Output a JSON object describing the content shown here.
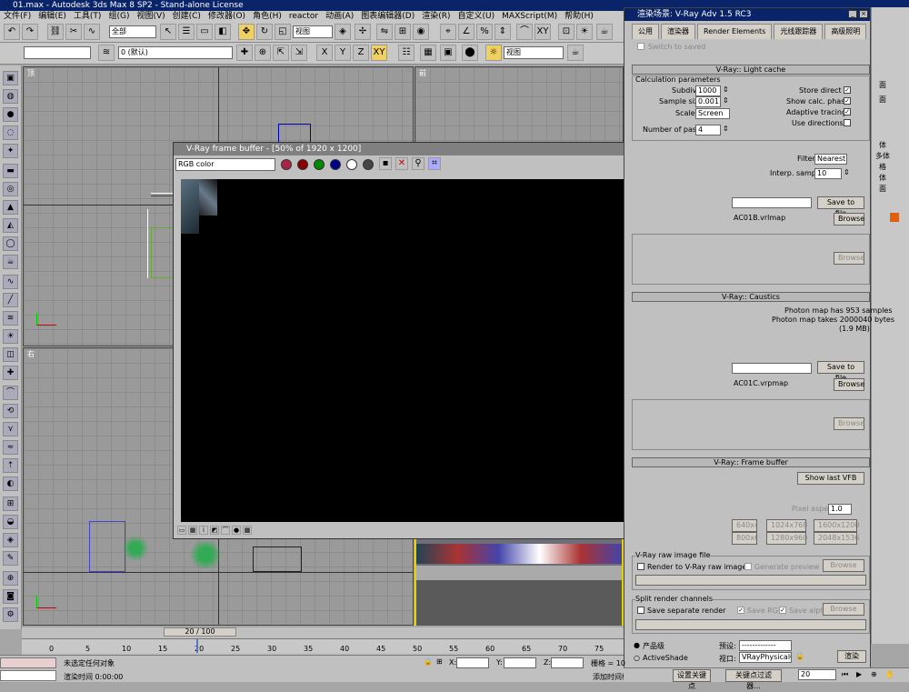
{
  "app": {
    "title": "01.max - Autodesk 3ds Max 8 SP2 - Stand-alone License"
  },
  "menu": [
    "文件(F)",
    "编辑(E)",
    "工具(T)",
    "组(G)",
    "视图(V)",
    "创建(C)",
    "修改器(O)",
    "角色(H)",
    "reactor",
    "动画(A)",
    "图表编辑器(D)",
    "渲染(R)",
    "自定义(U)",
    "MAXScript(M)",
    "帮助(H)"
  ],
  "toolbar": {
    "selection_filter": "全部",
    "ref_coord": "视图",
    "layer_value": "0 (默认)",
    "named_sel": "视图"
  },
  "viewports": {
    "top_left_label": "顶",
    "top_right_label": "前",
    "bottom_left_label": "右"
  },
  "vfb": {
    "title": "V-Ray frame buffer - [50% of 1920 x 1200]",
    "channel": "RGB color"
  },
  "render_dialog": {
    "title": "渲染场景: V-Ray Adv 1.5 RC3",
    "tabs": [
      "公用",
      "渲染器",
      "Render Elements",
      "光线跟踪器",
      "高级照明"
    ],
    "switch_to_saved": "Switch to saved",
    "light_cache_bar": "V-Ray:: Light cache",
    "calc_params": "Calculation parameters",
    "subdivs_label": "Subdivs:",
    "subdivs_value": "1000",
    "sample_size_label": "Sample size:",
    "sample_size_value": "0.001",
    "scale_label": "Scale:",
    "scale_value": "Screen",
    "passes_label": "Number of passes:",
    "passes_value": "4",
    "store_direct": "Store direct",
    "show_calc": "Show calc. phase",
    "adaptive": "Adaptive tracing",
    "use_dirs": "Use directions",
    "filter_label": "Filter:",
    "filter_value": "Nearest",
    "interp_label": "Interp. samples:",
    "interp_value": "10",
    "save_to_file": "Save to file",
    "lc_file": "AC01B.vrlmap",
    "browse": "Browse",
    "caustics_bar": "V-Ray:: Caustics",
    "photon_samples": "Photon map has 953 samples",
    "photon_bytes": "Photon map takes 2000040 bytes",
    "photon_mb": "(1.9 MB)",
    "caustic_file": "AC01C.vrpmap",
    "fb_bar": "V-Ray:: Frame buffer",
    "show_last_vfb": "Show last VFB",
    "pixel_aspect_label": "Pixel aspect:",
    "pixel_aspect_value": "1.0",
    "res_buttons": [
      "640x480",
      "1024x768",
      "1600x1200",
      "800x600",
      "1280x960",
      "2048x1536"
    ],
    "raw_group": "V-Ray raw image file",
    "render_raw": "Render to V-Ray raw image",
    "gen_preview": "Generate preview",
    "split_group": "Split render channels",
    "save_separate": "Save separate render",
    "save_rgb": "Save RGB",
    "save_alpha": "Save alpha",
    "product": "产品级",
    "activeshade": "ActiveShade",
    "preset_label": "预设:",
    "preset_value": "-------------",
    "viewport_label": "视口:",
    "viewport_value": "VRayPhysicalC",
    "render_btn": "渲染"
  },
  "right_labels": [
    "面",
    "面",
    "体",
    "多体",
    "格",
    "体",
    "面"
  ],
  "timeline": {
    "frame": "20 / 100",
    "ticks": [
      "0",
      "5",
      "10",
      "15",
      "20",
      "25",
      "30",
      "35",
      "40",
      "45",
      "50",
      "55",
      "60",
      "65",
      "70",
      "75"
    ]
  },
  "status": {
    "selection": "未选定任何对象",
    "render_time": "渲染时间  0:00:00",
    "x_label": "X:",
    "y_label": "Y:",
    "z_label": "Z:",
    "grid": "栅格 = 10",
    "add_time_tag": "添加时间标记",
    "set_key": "设置关键点",
    "key_filter": "关键点过滤器...",
    "frame_value": "20"
  }
}
